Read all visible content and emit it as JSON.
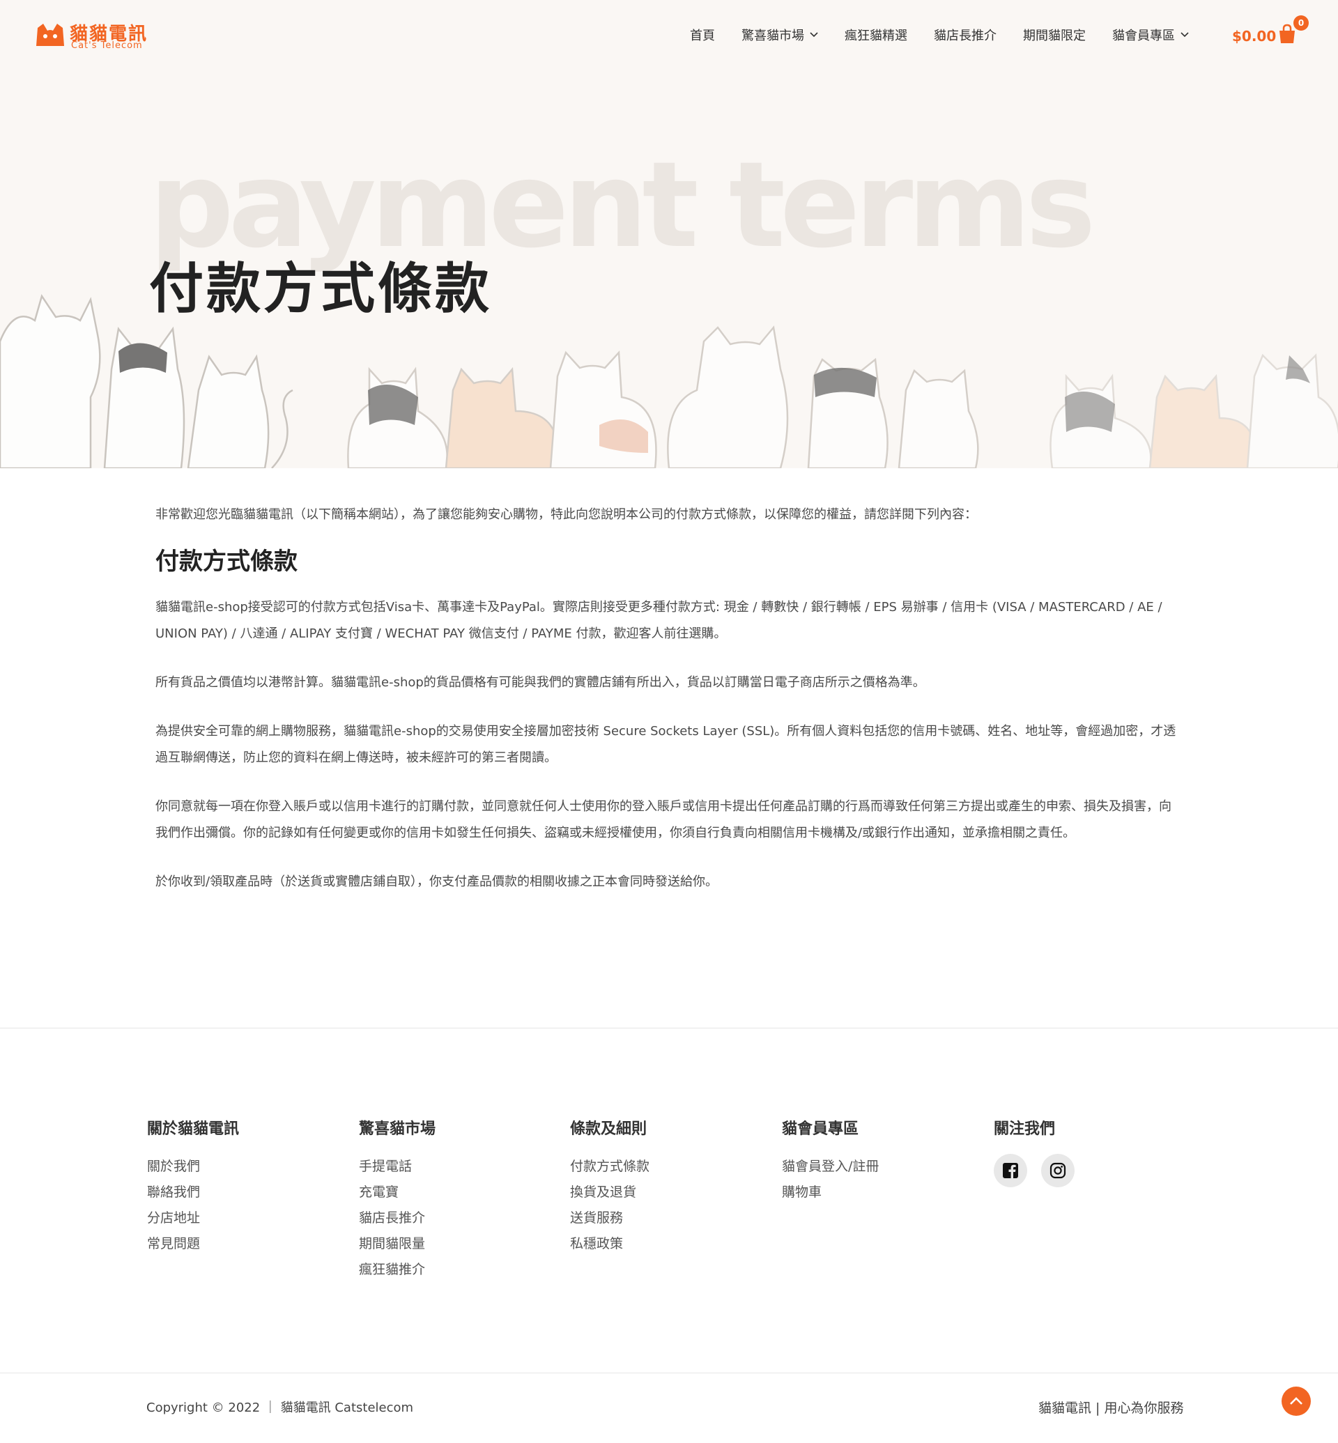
{
  "header": {
    "logo_title": "貓貓電訊",
    "logo_subtitle": "Cat's Telecom",
    "nav": [
      {
        "label": "首頁",
        "dropdown": false
      },
      {
        "label": "驚喜貓市場",
        "dropdown": true
      },
      {
        "label": "瘋狂貓精選",
        "dropdown": false
      },
      {
        "label": "貓店長推介",
        "dropdown": false
      },
      {
        "label": "期間貓限定",
        "dropdown": false
      },
      {
        "label": "貓會員專區",
        "dropdown": true
      }
    ],
    "cart_total": "$0.00",
    "cart_count": "0",
    "accent_color": "#f26522"
  },
  "hero": {
    "background_text": "payment terms",
    "title": "付款方式條款"
  },
  "content": {
    "intro": "非常歡迎您光臨貓貓電訊（以下簡稱本網站），為了讓您能夠安心購物，特此向您說明本公司的付款方式條款，以保障您的權益，請您詳閱下列內容：",
    "heading": "付款方式條款",
    "paragraphs": [
      "貓貓電訊e-shop接受認可的付款方式包括Visa卡、萬事達卡及PayPal。實際店則接受更多種付款方式: 現金 / 轉數快 / 銀行轉帳 / EPS 易辦事 / 信用卡 (VISA / MASTERCARD / AE / UNION PAY) / 八達通 / ALIPAY 支付寶 / WECHAT PAY 微信支付 / PAYME 付款，歡迎客人前往選購。",
      "所有貨品之價值均以港幣計算。貓貓電訊e-shop的貨品價格有可能與我們的實體店鋪有所出入，貨品以訂購當日電子商店所示之價格為準。",
      "為提供安全可靠的網上購物服務，貓貓電訊e-shop的交易使用安全接層加密技術 Secure Sockets Layer (SSL)。所有個人資料包括您的信用卡號碼、姓名、地址等，會經過加密，才透過互聯網傳送，防止您的資料在網上傳送時，被未經許可的第三者閱讀。",
      "你同意就每一項在你登入賬戶或以信用卡進行的訂購付款，並同意就任何人士使用你的登入賬戶或信用卡提出任何產品訂購的行爲而導致任何第三方提出或產生的申索、損失及損害，向我們作出彌償。你的記錄如有任何變更或你的信用卡如發生任何損失、盜竊或未經授權使用，你須自行負責向相關信用卡機構及/或銀行作出通知，並承擔相關之責任。",
      "於你收到/領取產品時（於送貨或實體店鋪自取），你支付產品價款的相關收據之正本會同時發送給你。"
    ]
  },
  "footer": {
    "columns": [
      {
        "heading": "關於貓貓電訊",
        "links": [
          "關於我們",
          "聯絡我們",
          "分店地址",
          "常見問題"
        ]
      },
      {
        "heading": "驚喜貓市場",
        "links": [
          "手提電話",
          "充電寶",
          "貓店長推介",
          "期間貓限量",
          "瘋狂貓推介"
        ]
      },
      {
        "heading": "條款及細則",
        "links": [
          "付款方式條款",
          "換貨及退貨",
          "送貨服務",
          "私穩政策"
        ]
      },
      {
        "heading": "貓會員專區",
        "links": [
          "貓會員登入/註冊",
          "購物車"
        ]
      }
    ],
    "follow_heading": "關注我們",
    "social": [
      "facebook-icon",
      "instagram-icon"
    ],
    "copyright": "Copyright © 2022 ｜ 貓貓電訊 Catstelecom",
    "tagline": "貓貓電訊 | 用心為你服務"
  }
}
